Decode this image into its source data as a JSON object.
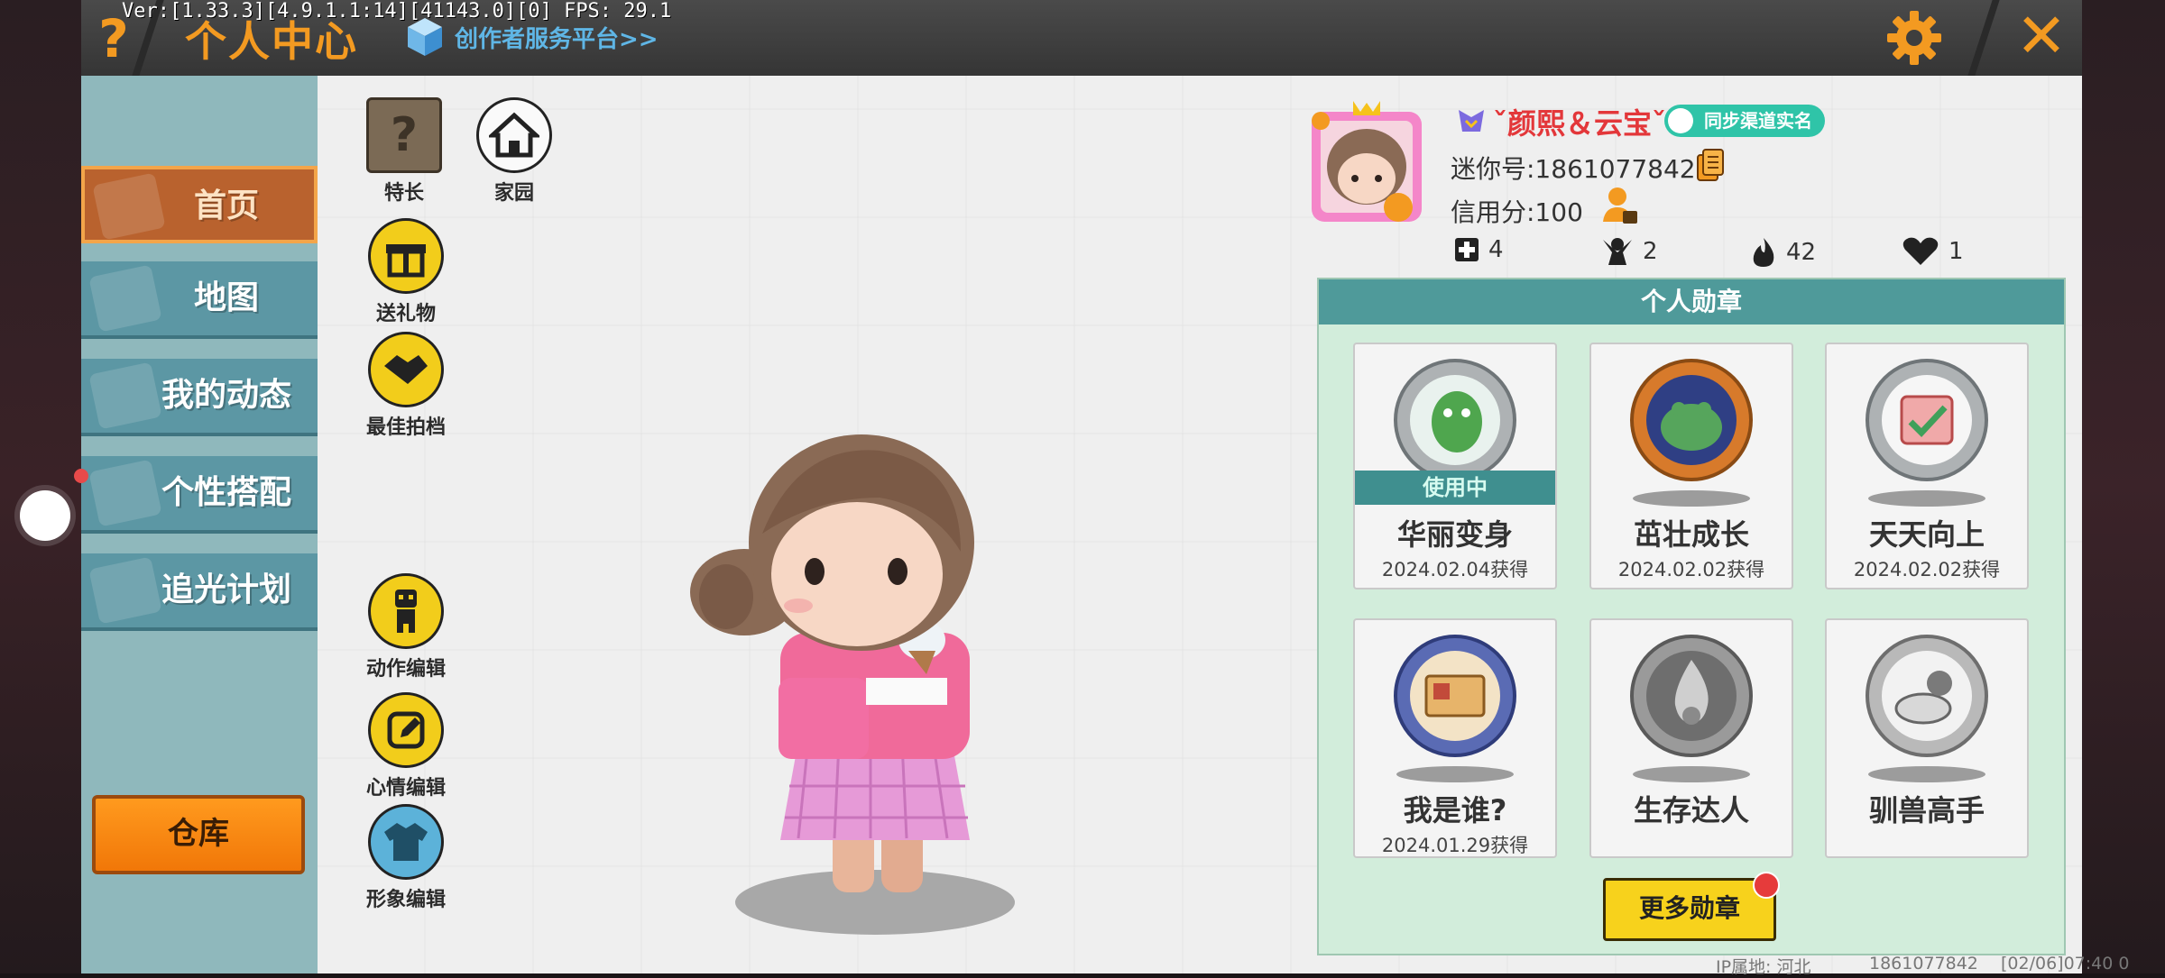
{
  "debug_overlay": "Ver:[1.33.3][4.9.1.1:14][41143.0][0] FPS: 29.1",
  "header": {
    "help_icon": "question-mark",
    "title": "个人中心",
    "creator_link": "创作者服务平台>>",
    "settings_icon": "gear-icon",
    "close_icon": "close-icon",
    "accent_color": "#f39a21"
  },
  "sidebar": {
    "items": [
      {
        "label": "首页",
        "active": true
      },
      {
        "label": "地图",
        "active": false
      },
      {
        "label": "我的动态",
        "active": false
      },
      {
        "label": "个性搭配",
        "active": false
      },
      {
        "label": "追光计划",
        "active": false
      }
    ],
    "warehouse_label": "仓库"
  },
  "features": {
    "specialty": "特长",
    "home": "家园",
    "gift": "送礼物",
    "partner": "最佳拍档",
    "action_edit": "动作编辑",
    "mood_edit": "心情编辑",
    "image_edit": "形象编辑"
  },
  "profile": {
    "name": "ˇ颜熙＆云宝ˇ",
    "sync_realname": "同步渠道实名",
    "mini_id": "迷你号:1861077842",
    "credit": "信用分:100",
    "stats": {
      "plus": "4",
      "fans": "2",
      "fire": "42",
      "likes": "1"
    }
  },
  "medals": {
    "title": "个人勋章",
    "in_use_label": "使用中",
    "items": [
      {
        "name": "华丽变身",
        "date": "2024.02.04获得",
        "in_use": true
      },
      {
        "name": "茁壮成长",
        "date": "2024.02.02获得"
      },
      {
        "name": "天天向上",
        "date": "2024.02.02获得"
      },
      {
        "name": "我是谁?",
        "date": "2024.01.29获得"
      },
      {
        "name": "生存达人",
        "date": ""
      },
      {
        "name": "驯兽高手",
        "date": ""
      }
    ],
    "more_label": "更多勋章"
  },
  "footer": {
    "ip_location": "IP属地: 河北",
    "uid": "1861077842",
    "time": "[02/06]07:40 0"
  }
}
